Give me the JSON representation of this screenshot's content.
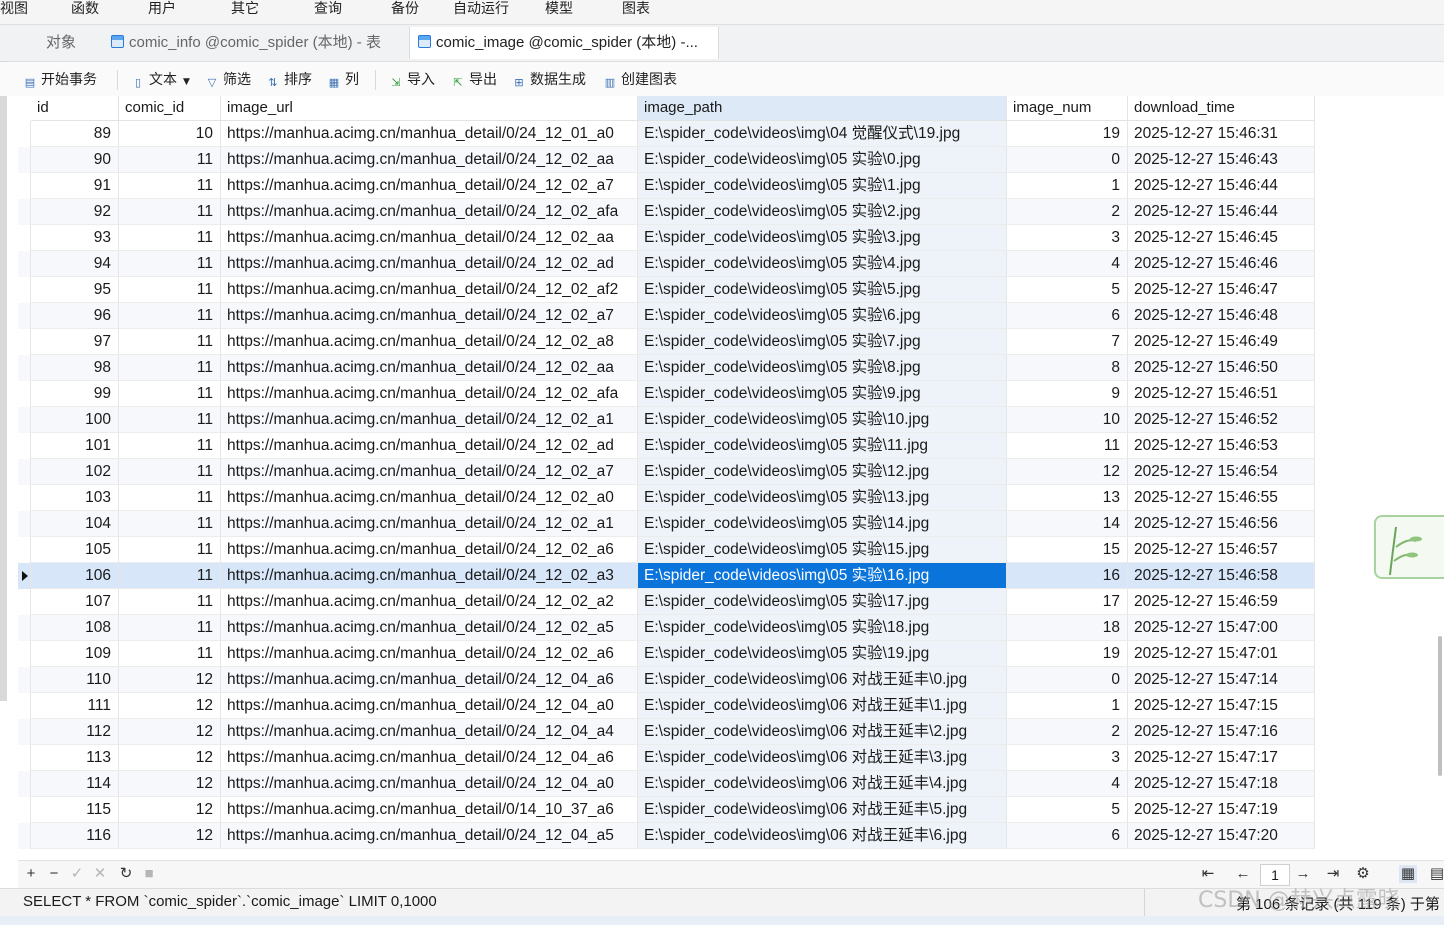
{
  "menu": [
    "视图",
    "函数",
    "用户",
    "其它",
    "查询",
    "备份",
    "自动运行",
    "模型",
    "图表"
  ],
  "tabs": [
    {
      "label": "对象"
    },
    {
      "label": "comic_info @comic_spider (本地) - 表"
    },
    {
      "label": "comic_image @comic_spider (本地) -..."
    }
  ],
  "toolbar": {
    "begin_transaction": "开始事务",
    "text": "文本",
    "filter": "筛选",
    "sort": "排序",
    "columns": "列",
    "import": "导入",
    "export": "导出",
    "data_generation": "数据生成",
    "create_chart": "创建图表"
  },
  "table": {
    "columns": [
      "id",
      "comic_id",
      "image_url",
      "image_path",
      "image_num",
      "download_time"
    ],
    "rows": [
      [
        "89",
        "10",
        "https://manhua.acimg.cn/manhua_detail/0/24_12_01_a0",
        "E:\\spider_code\\videos\\img\\04 觉醒仪式\\19.jpg",
        "19",
        "2025-12-27 15:46:31"
      ],
      [
        "90",
        "11",
        "https://manhua.acimg.cn/manhua_detail/0/24_12_02_aa",
        "E:\\spider_code\\videos\\img\\05 实验\\0.jpg",
        "0",
        "2025-12-27 15:46:43"
      ],
      [
        "91",
        "11",
        "https://manhua.acimg.cn/manhua_detail/0/24_12_02_a7",
        "E:\\spider_code\\videos\\img\\05 实验\\1.jpg",
        "1",
        "2025-12-27 15:46:44"
      ],
      [
        "92",
        "11",
        "https://manhua.acimg.cn/manhua_detail/0/24_12_02_afa",
        "E:\\spider_code\\videos\\img\\05 实验\\2.jpg",
        "2",
        "2025-12-27 15:46:44"
      ],
      [
        "93",
        "11",
        "https://manhua.acimg.cn/manhua_detail/0/24_12_02_aa",
        "E:\\spider_code\\videos\\img\\05 实验\\3.jpg",
        "3",
        "2025-12-27 15:46:45"
      ],
      [
        "94",
        "11",
        "https://manhua.acimg.cn/manhua_detail/0/24_12_02_ad",
        "E:\\spider_code\\videos\\img\\05 实验\\4.jpg",
        "4",
        "2025-12-27 15:46:46"
      ],
      [
        "95",
        "11",
        "https://manhua.acimg.cn/manhua_detail/0/24_12_02_af2",
        "E:\\spider_code\\videos\\img\\05 实验\\5.jpg",
        "5",
        "2025-12-27 15:46:47"
      ],
      [
        "96",
        "11",
        "https://manhua.acimg.cn/manhua_detail/0/24_12_02_a7",
        "E:\\spider_code\\videos\\img\\05 实验\\6.jpg",
        "6",
        "2025-12-27 15:46:48"
      ],
      [
        "97",
        "11",
        "https://manhua.acimg.cn/manhua_detail/0/24_12_02_a8",
        "E:\\spider_code\\videos\\img\\05 实验\\7.jpg",
        "7",
        "2025-12-27 15:46:49"
      ],
      [
        "98",
        "11",
        "https://manhua.acimg.cn/manhua_detail/0/24_12_02_aa",
        "E:\\spider_code\\videos\\img\\05 实验\\8.jpg",
        "8",
        "2025-12-27 15:46:50"
      ],
      [
        "99",
        "11",
        "https://manhua.acimg.cn/manhua_detail/0/24_12_02_afa",
        "E:\\spider_code\\videos\\img\\05 实验\\9.jpg",
        "9",
        "2025-12-27 15:46:51"
      ],
      [
        "100",
        "11",
        "https://manhua.acimg.cn/manhua_detail/0/24_12_02_a1",
        "E:\\spider_code\\videos\\img\\05 实验\\10.jpg",
        "10",
        "2025-12-27 15:46:52"
      ],
      [
        "101",
        "11",
        "https://manhua.acimg.cn/manhua_detail/0/24_12_02_ad",
        "E:\\spider_code\\videos\\img\\05 实验\\11.jpg",
        "11",
        "2025-12-27 15:46:53"
      ],
      [
        "102",
        "11",
        "https://manhua.acimg.cn/manhua_detail/0/24_12_02_a7",
        "E:\\spider_code\\videos\\img\\05 实验\\12.jpg",
        "12",
        "2025-12-27 15:46:54"
      ],
      [
        "103",
        "11",
        "https://manhua.acimg.cn/manhua_detail/0/24_12_02_a0",
        "E:\\spider_code\\videos\\img\\05 实验\\13.jpg",
        "13",
        "2025-12-27 15:46:55"
      ],
      [
        "104",
        "11",
        "https://manhua.acimg.cn/manhua_detail/0/24_12_02_a1",
        "E:\\spider_code\\videos\\img\\05 实验\\14.jpg",
        "14",
        "2025-12-27 15:46:56"
      ],
      [
        "105",
        "11",
        "https://manhua.acimg.cn/manhua_detail/0/24_12_02_a6",
        "E:\\spider_code\\videos\\img\\05 实验\\15.jpg",
        "15",
        "2025-12-27 15:46:57"
      ],
      [
        "106",
        "11",
        "https://manhua.acimg.cn/manhua_detail/0/24_12_02_a3",
        "E:\\spider_code\\videos\\img\\05 实验\\16.jpg",
        "16",
        "2025-12-27 15:46:58"
      ],
      [
        "107",
        "11",
        "https://manhua.acimg.cn/manhua_detail/0/24_12_02_a2",
        "E:\\spider_code\\videos\\img\\05 实验\\17.jpg",
        "17",
        "2025-12-27 15:46:59"
      ],
      [
        "108",
        "11",
        "https://manhua.acimg.cn/manhua_detail/0/24_12_02_a5",
        "E:\\spider_code\\videos\\img\\05 实验\\18.jpg",
        "18",
        "2025-12-27 15:47:00"
      ],
      [
        "109",
        "11",
        "https://manhua.acimg.cn/manhua_detail/0/24_12_02_a6",
        "E:\\spider_code\\videos\\img\\05 实验\\19.jpg",
        "19",
        "2025-12-27 15:47:01"
      ],
      [
        "110",
        "12",
        "https://manhua.acimg.cn/manhua_detail/0/24_12_04_a6",
        "E:\\spider_code\\videos\\img\\06 对战王延丰\\0.jpg",
        "0",
        "2025-12-27 15:47:14"
      ],
      [
        "111",
        "12",
        "https://manhua.acimg.cn/manhua_detail/0/24_12_04_a0",
        "E:\\spider_code\\videos\\img\\06 对战王延丰\\1.jpg",
        "1",
        "2025-12-27 15:47:15"
      ],
      [
        "112",
        "12",
        "https://manhua.acimg.cn/manhua_detail/0/24_12_04_a4",
        "E:\\spider_code\\videos\\img\\06 对战王延丰\\2.jpg",
        "2",
        "2025-12-27 15:47:16"
      ],
      [
        "113",
        "12",
        "https://manhua.acimg.cn/manhua_detail/0/24_12_04_a6",
        "E:\\spider_code\\videos\\img\\06 对战王延丰\\3.jpg",
        "3",
        "2025-12-27 15:47:17"
      ],
      [
        "114",
        "12",
        "https://manhua.acimg.cn/manhua_detail/0/24_12_04_a0",
        "E:\\spider_code\\videos\\img\\06 对战王延丰\\4.jpg",
        "4",
        "2025-12-27 15:47:18"
      ],
      [
        "115",
        "12",
        "https://manhua.acimg.cn/manhua_detail/0/14_10_37_a6",
        "E:\\spider_code\\videos\\img\\06 对战王延丰\\5.jpg",
        "5",
        "2025-12-27 15:47:19"
      ],
      [
        "116",
        "12",
        "https://manhua.acimg.cn/manhua_detail/0/24_12_04_a5",
        "E:\\spider_code\\videos\\img\\06 对战王延丰\\6.jpg",
        "6",
        "2025-12-27 15:47:20"
      ]
    ],
    "current_row_id": "106"
  },
  "pager": {
    "page": "1"
  },
  "status": {
    "sql": "SELECT * FROM `comic_spider`.`comic_image` LIMIT 0,1000",
    "record": "第 106 条记录 (共 119 条) 于第"
  },
  "watermark": "CSDN @赫兴点露晓",
  "colors": {
    "selection": "#0a74da",
    "current_row": "#d7e6f8",
    "alt_row": "#f6f8fc"
  }
}
